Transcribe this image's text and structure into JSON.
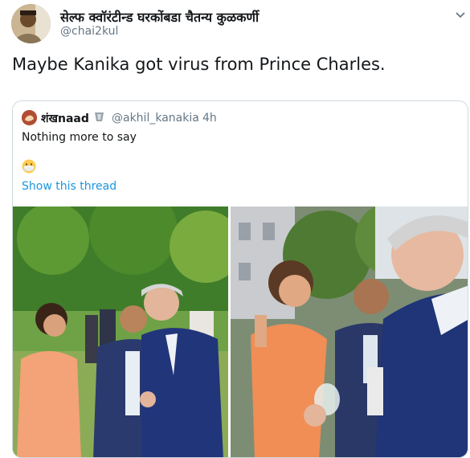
{
  "tweet": {
    "author_name": "सेल्फ क्वॉरंटीन्ड घरकोंबडा चैतन्य कुळकर्णी",
    "author_handle": "@chai2kul",
    "text": "Maybe Kanika got virus from Prince Charles."
  },
  "quoted_tweet": {
    "author_name": "शंखnaad",
    "author_handle": "@akhil_kanakia",
    "separator": "·",
    "time": "4h",
    "text": "Nothing more to say",
    "emoji": "face-with-medical-mask-icon",
    "show_thread_label": "Show this thread"
  },
  "colors": {
    "link": "#1b95e0",
    "secondary_text": "#657786",
    "border": "#cfd9de"
  }
}
